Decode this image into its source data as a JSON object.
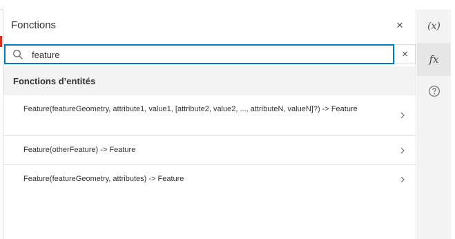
{
  "panel": {
    "title": "Fonctions",
    "close_label": "×"
  },
  "search": {
    "value": "feature",
    "clear_label": "×"
  },
  "group": {
    "title": "Fonctions d’entités"
  },
  "items": [
    {
      "text": "Feature(featureGeometry, attribute1, value1, [attribute2, value2, ..., attributeN, valueN]?) -> Feature"
    },
    {
      "text": "Feature(otherFeature) -> Feature"
    },
    {
      "text": "Feature(featureGeometry, attributes) -> Feature"
    }
  ],
  "toolbar": {
    "variables_label": "(x)",
    "functions_label": "fx",
    "help_icon": "help-circle-icon"
  },
  "colors": {
    "accent": "#007ac2",
    "marker": "#d83020",
    "toolbar_bg": "#f3f3f3",
    "toolbar_active": "#e6e6e6"
  }
}
